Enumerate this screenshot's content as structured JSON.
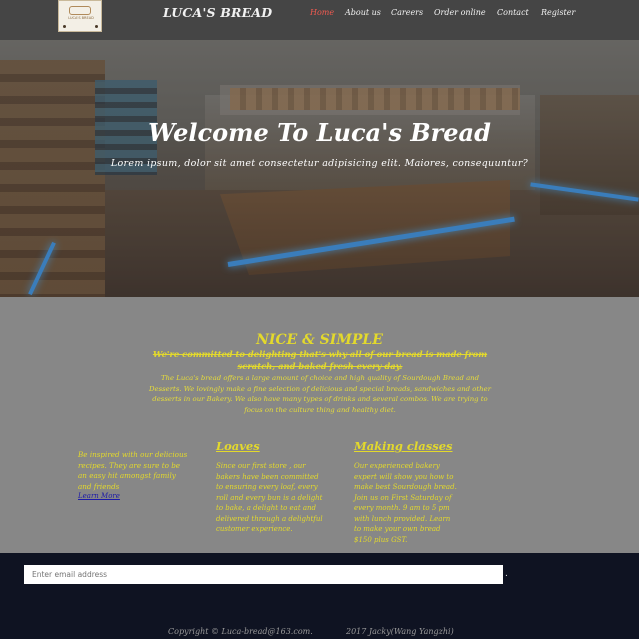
{
  "header": {
    "logo_text": "LUCA'S BREAD",
    "brand": "LUCA'S BREAD",
    "nav": [
      {
        "label": "Home",
        "active": true
      },
      {
        "label": "About us",
        "active": false
      },
      {
        "label": "Careers",
        "active": false
      },
      {
        "label": "Order online",
        "active": false
      },
      {
        "label": "Contact",
        "active": false
      },
      {
        "label": "Register",
        "active": false
      }
    ],
    "active_color": "#f05a50"
  },
  "hero": {
    "title": "Welcome To Luca's Bread",
    "subtitle": "Lorem ipsum, dolor sit amet consectetur adipisicing elit. Maiores, consequuntur?"
  },
  "about": {
    "title": "NICE & SIMPLE",
    "lead": "We're committed to delighting that's why all of our bread is made from scratch, and baked fresh every day.",
    "body": "The Luca's bread offers a large amount of choice and high quality of Sourdough Bread and Desserts. We lovingly make a fine selection of delicious and special breads, sandwiches and other desserts in our Bakery. We also have many types of drinks and several combos. We are trying to focus on the culture thing and healthy diet.",
    "accent_color": "#e3d92c",
    "columns": [
      {
        "heading": "",
        "text": "Be inspired with our delicious recipes. They are sure to be an easy hit amongst family and friends",
        "link": "Learn More"
      },
      {
        "heading": "Loaves",
        "text": "Since our first store , our bakers have been committed to ensuring every loaf, every roll and every bun is a delight to bake, a delight to eat and delivered through a delightful customer experience."
      },
      {
        "heading": "Making classes",
        "text": "Our experienced bakery expert will show you how to make best Sourdough bread. Join us on First Saturday of every month. 9 am to 5 pm with lunch provided. Learn to make your own bread $150 plus GST."
      }
    ]
  },
  "footer": {
    "email_placeholder": "Enter email address",
    "submit_label": ".",
    "copyright": "Copyright © Luca-bread@163.com.",
    "credit": "2017 Jacky(Wang Yangzhi)"
  }
}
